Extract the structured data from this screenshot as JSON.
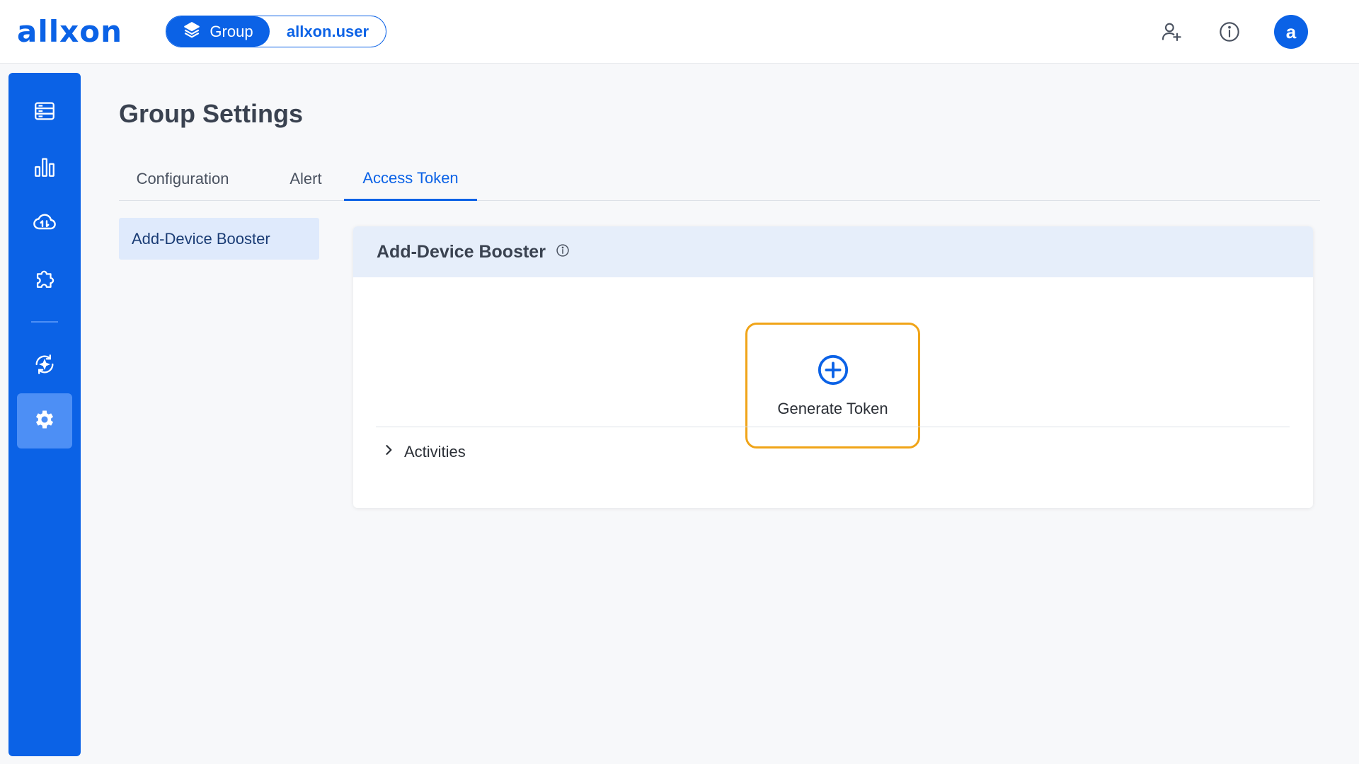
{
  "header": {
    "logo_text": "allxon",
    "scope": {
      "group_label": "Group",
      "user_label": "allxon.user"
    },
    "icons": [
      "add-user-icon",
      "info-icon"
    ],
    "avatar_letter": "a"
  },
  "sidebar": {
    "items": [
      {
        "icon": "devices-icon"
      },
      {
        "icon": "analytics-chart-icon"
      },
      {
        "icon": "cloud-sync-icon"
      },
      {
        "icon": "plugin-puzzle-icon"
      },
      {
        "icon": "ota-update-icon"
      },
      {
        "icon": "settings-gear-icon",
        "active": true
      }
    ]
  },
  "page": {
    "title": "Group Settings",
    "tabs": [
      {
        "label": "Configuration"
      },
      {
        "label": "Alert"
      },
      {
        "label": "Access Token",
        "active": true
      }
    ],
    "subnav": [
      {
        "label": "Add-Device Booster",
        "active": true
      }
    ],
    "card": {
      "title": "Add-Device Booster",
      "generate_label": "Generate Token",
      "activities_label": "Activities"
    }
  },
  "colors": {
    "primary": "#0b62e6",
    "highlight": "#f0a418",
    "header_bg": "#e6eefa",
    "subnav_bg": "#dfeafc"
  }
}
